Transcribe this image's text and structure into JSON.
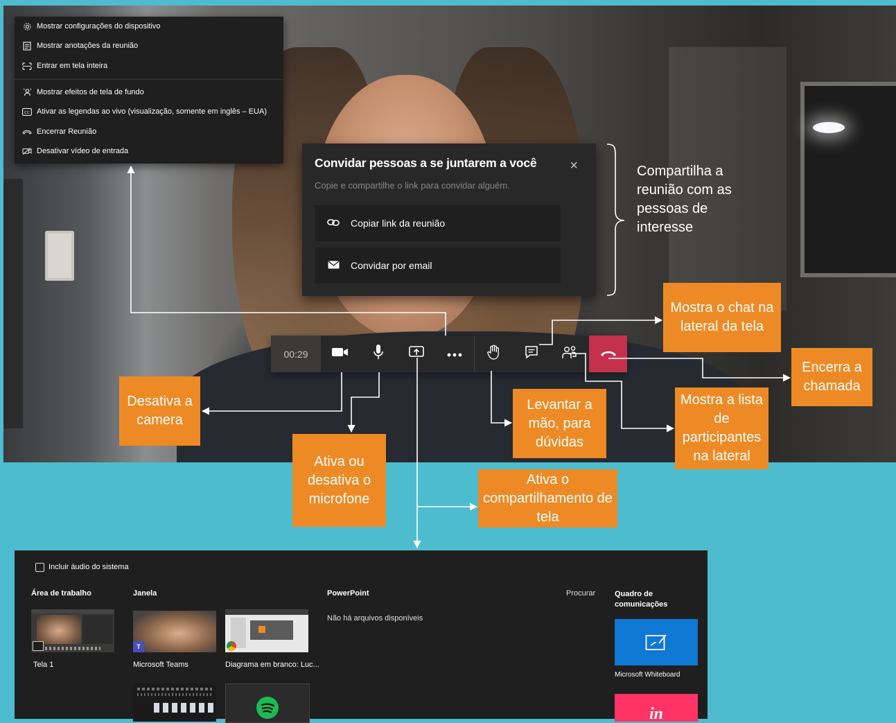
{
  "menu": {
    "items": [
      {
        "icon": "gear-icon",
        "label": "Mostrar configurações do dispositivo"
      },
      {
        "icon": "notes-icon",
        "label": "Mostrar anotações da reunião"
      },
      {
        "icon": "fullscreen-icon",
        "label": "Entrar em tela inteira"
      },
      {
        "icon": "background-effects-icon",
        "label": "Mostrar efeitos de tela de fundo"
      },
      {
        "icon": "captions-icon",
        "label": "Ativar as legendas ao vivo (visualização, somente em inglês – EUA)"
      },
      {
        "icon": "end-meeting-icon",
        "label": "Encerrar Reunião"
      },
      {
        "icon": "video-off-icon",
        "label": "Desativar vídeo de entrada"
      }
    ]
  },
  "invite": {
    "title": "Convidar pessoas a se juntarem a você",
    "subtitle": "Copie e compartilhe o link para convidar alguém.",
    "copy_link": "Copiar link da reunião",
    "email": "Convidar por email"
  },
  "callbar": {
    "timer": "00:29"
  },
  "annotations": {
    "share_meeting": "Compartilha a reunião com as pessoas de interesse",
    "chat": "Mostra o chat na lateral da tela",
    "end_call": "Encerra a chamada",
    "camera": "Desativa a camera",
    "mic": "Ativa ou desativa o microfone",
    "raise_hand": "Levantar a mão, para dúvidas",
    "participants": "Mostra a lista de participantes na lateral",
    "screen_share": "Ativa o compartilhamento de tela"
  },
  "tray": {
    "include_audio": "Incluir áudio do sistema",
    "desktop_header": "Área de trabalho",
    "window_header": "Janela",
    "powerpoint_header": "PowerPoint",
    "browse": "Procurar",
    "whiteboard_header": "Quadro de comunicações",
    "no_files": "Não há arquivos disponíveis",
    "screen1": "Tela 1",
    "teams_window": "Microsoft Teams",
    "diagram_window": "Diagrama em branco: Luc...",
    "whiteboard_app": "Microsoft Whiteboard",
    "invision_logo": "in"
  },
  "colors": {
    "background": "#4ebccf",
    "annotation": "#ee8a25",
    "hangup": "#c4314b",
    "whiteboard": "#0f78d4",
    "invision": "#ff3366",
    "spotify": "#1db954"
  }
}
